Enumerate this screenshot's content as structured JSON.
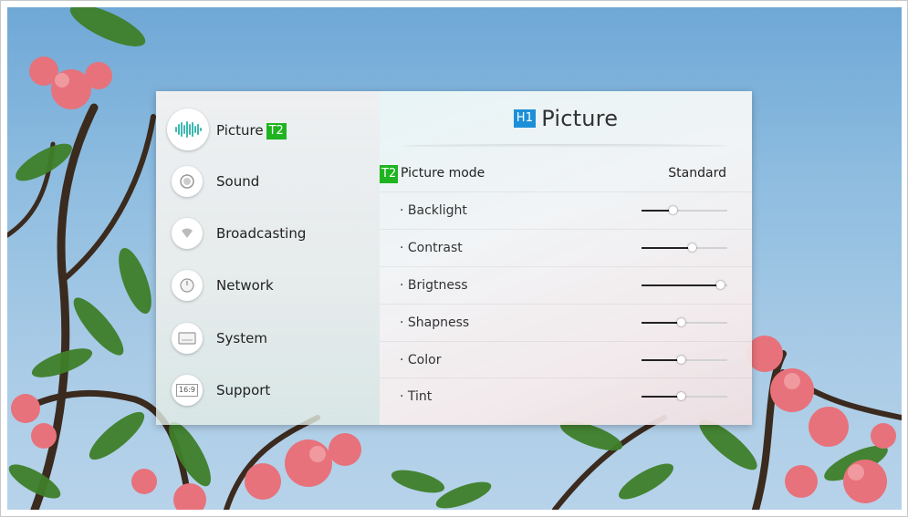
{
  "menu": {
    "items": [
      {
        "label": "Picture",
        "icon": "waveform-icon",
        "badge": "T2",
        "selected": true
      },
      {
        "label": "Sound",
        "icon": "speaker-icon"
      },
      {
        "label": "Broadcasting",
        "icon": "broadcast-icon"
      },
      {
        "label": "Network",
        "icon": "network-icon"
      },
      {
        "label": "System",
        "icon": "system-icon"
      },
      {
        "label": "Support",
        "icon": "support-icon",
        "icon_text": "16:9"
      }
    ]
  },
  "detail": {
    "title_badge": "H1",
    "title": "Picture",
    "mode_badge": "T2",
    "mode_label": "Picture mode",
    "mode_value": "Standard",
    "settings": [
      {
        "label": "· Backlight",
        "level": 0.36
      },
      {
        "label": "· Contrast",
        "level": 0.58
      },
      {
        "label": "· Brigtness",
        "level": 0.91
      },
      {
        "label": "· Shapness",
        "level": 0.46
      },
      {
        "label": "· Color",
        "level": 0.46
      },
      {
        "label": "· Tint",
        "level": 0.46
      }
    ]
  },
  "colors": {
    "tag_green": "#1fb41f",
    "tag_blue": "#1d8fd8",
    "accent": "#3cb9b0"
  }
}
